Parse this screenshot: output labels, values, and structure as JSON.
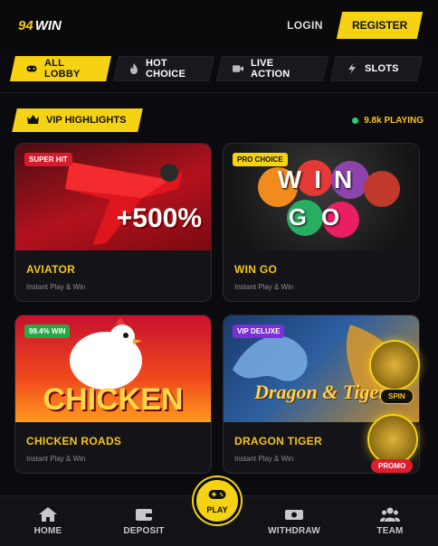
{
  "header": {
    "logo_number": "94",
    "logo_word": "WIN",
    "login_label": "LOGIN",
    "register_label": "REGISTER"
  },
  "tabs": [
    {
      "label": "ALL LOBBY",
      "icon": "gamepad-icon",
      "active": true
    },
    {
      "label": "HOT CHOICE",
      "icon": "flame-icon",
      "active": false
    },
    {
      "label": "LIVE ACTION",
      "icon": "video-icon",
      "active": false
    },
    {
      "label": "SLOTS",
      "icon": "lightning-icon",
      "active": false
    }
  ],
  "section": {
    "title": "VIP HIGHLIGHTS",
    "playing_count": "9.8k PLAYING"
  },
  "games": [
    {
      "title": "AVIATOR",
      "subtitle": "Instant Play & Win",
      "badge": "SUPER HIT",
      "badge_color": "#d81b2b",
      "art_text": "+500%"
    },
    {
      "title": "WIN GO",
      "subtitle": "Instant Play & Win",
      "badge": "PRO CHOICE",
      "badge_color": "#f5d312",
      "art_text_top": "WIN",
      "art_text_bottom": "GO"
    },
    {
      "title": "CHICKEN ROADS",
      "subtitle": "Instant Play & Win",
      "badge": "98.4% WIN",
      "badge_color": "#27a844",
      "art_text": "CHICKEN"
    },
    {
      "title": "DRAGON TIGER",
      "subtitle": "Instant Play & Win",
      "badge": "VIP DELUXE",
      "badge_color": "#7b2fd6",
      "art_text": "Dragon & Tiger"
    }
  ],
  "floating": {
    "spin_label": "SPIN",
    "promo_label": "PROMO"
  },
  "bottom_nav": {
    "home": "HOME",
    "deposit": "DEPOSIT",
    "play": "PLAY",
    "withdraw": "WITHDRAW",
    "team": "TEAM"
  },
  "colors": {
    "accent": "#f5d312",
    "background": "#0b0b0f",
    "live_dot": "#2ecc71"
  }
}
